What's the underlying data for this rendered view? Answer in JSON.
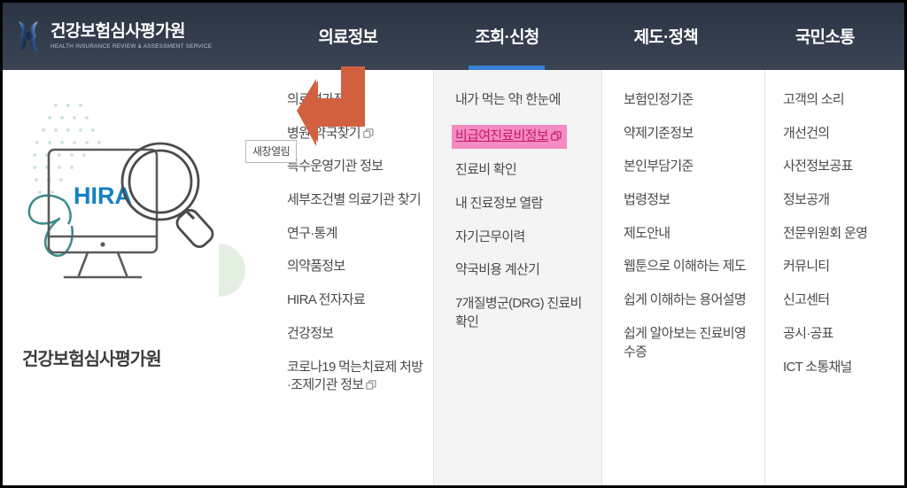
{
  "header": {
    "brand": {
      "title": "건강보험심사평가원",
      "subtitle": "HEALTH INSURANCE REVIEW & ASSESSMENT SERVICE",
      "logo_icon": "hira-ribbon-logo-icon"
    },
    "nav": [
      {
        "label": "의료정보",
        "active": false
      },
      {
        "label": "조회·신청",
        "active": true
      },
      {
        "label": "제도·정책",
        "active": false
      },
      {
        "label": "국민소통",
        "active": false
      }
    ]
  },
  "promo": {
    "screen_text": "HIRA",
    "caption": "건강보험심사평가원",
    "icons": [
      "monitor-icon",
      "magnifier-icon",
      "ribbon-icon",
      "dot-pattern-icon",
      "half-circle-icon"
    ]
  },
  "menu": {
    "columns": [
      {
        "name": "의료정보",
        "items": [
          {
            "label": "의료평가정보",
            "new_window": false
          },
          {
            "label": "병원·약국찾기",
            "new_window": true
          },
          {
            "label": "특수운영기관 정보",
            "new_window": false
          },
          {
            "label": "세부조건별 의료기관 찾기",
            "new_window": false
          },
          {
            "label": "연구·통계",
            "new_window": false
          },
          {
            "label": "의약품정보",
            "new_window": false
          },
          {
            "label": "HIRA 전자자료",
            "new_window": false
          },
          {
            "label": "건강정보",
            "new_window": false
          },
          {
            "label": "코로나19 먹는치료제 처방·조제기관 정보",
            "new_window": true
          }
        ]
      },
      {
        "name": "조회·신청",
        "items": [
          {
            "label": "내가 먹는 약! 한눈에",
            "new_window": false
          },
          {
            "label": "비급여진료비정보",
            "new_window": true,
            "highlighted": true,
            "tooltip": "새창열림"
          },
          {
            "label": "진료비 확인",
            "new_window": false
          },
          {
            "label": "내 진료정보 열람",
            "new_window": false
          },
          {
            "label": "자기근무이력",
            "new_window": false
          },
          {
            "label": "약국비용 계산기",
            "new_window": false
          },
          {
            "label": "7개질병군(DRG) 진료비 확인",
            "new_window": false
          }
        ]
      },
      {
        "name": "제도·정책",
        "items": [
          {
            "label": "보험인정기준",
            "new_window": false
          },
          {
            "label": "약제기준정보",
            "new_window": false
          },
          {
            "label": "본인부담기준",
            "new_window": false
          },
          {
            "label": "법령정보",
            "new_window": false
          },
          {
            "label": "제도안내",
            "new_window": false
          },
          {
            "label": "웹툰으로 이해하는 제도",
            "new_window": false
          },
          {
            "label": "쉽게 이해하는 용어설명",
            "new_window": false
          },
          {
            "label": "쉽게 알아보는 진료비영수증",
            "new_window": false
          }
        ]
      },
      {
        "name": "국민소통",
        "items": [
          {
            "label": "고객의 소리",
            "new_window": false
          },
          {
            "label": "개선건의",
            "new_window": false
          },
          {
            "label": "사전정보공표",
            "new_window": false
          },
          {
            "label": "정보공개",
            "new_window": false
          },
          {
            "label": "전문위원회 운영",
            "new_window": false
          },
          {
            "label": "커뮤니티",
            "new_window": false
          },
          {
            "label": "신고센터",
            "new_window": false
          },
          {
            "label": "공시·공표",
            "new_window": false
          },
          {
            "label": "ICT 소통채널",
            "new_window": false
          }
        ]
      }
    ]
  },
  "cursor": {
    "icon": "arrow-down-left-cursor-icon",
    "color": "#d2603e"
  },
  "colors": {
    "header_bg": "#333d4d",
    "accent_blue": "#3b82d6",
    "highlight_pink": "#f48cc0",
    "highlight_text": "#c7186f",
    "cursor_orange": "#d2603e",
    "column_alt_bg": "#f4f4f4",
    "hira_blue": "#1380c4"
  }
}
